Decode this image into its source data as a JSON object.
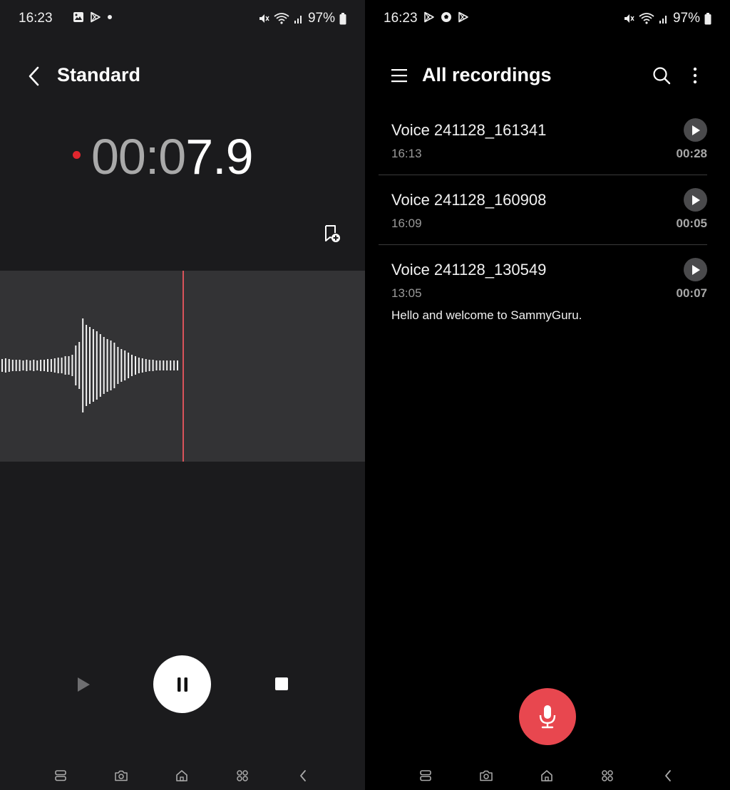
{
  "left": {
    "status": {
      "time": "16:23",
      "battery": "97%"
    },
    "header": {
      "title": "Standard"
    },
    "timer": {
      "dim_part": "00:0",
      "bright_part": "7.9"
    },
    "colors": {
      "record_red": "#e0262e",
      "cursor": "#d9535a"
    }
  },
  "right": {
    "status": {
      "time": "16:23",
      "battery": "97%"
    },
    "header": {
      "title": "All recordings"
    },
    "recordings": [
      {
        "name": "Voice 241128_161341",
        "time": "16:13",
        "duration": "00:28"
      },
      {
        "name": "Voice 241128_160908",
        "time": "16:09",
        "duration": "00:05"
      },
      {
        "name": "Voice 241128_130549",
        "time": "13:05",
        "duration": "00:07",
        "transcript": "Hello and welcome to SammyGuru."
      }
    ],
    "colors": {
      "fab": "#e8474f"
    }
  }
}
